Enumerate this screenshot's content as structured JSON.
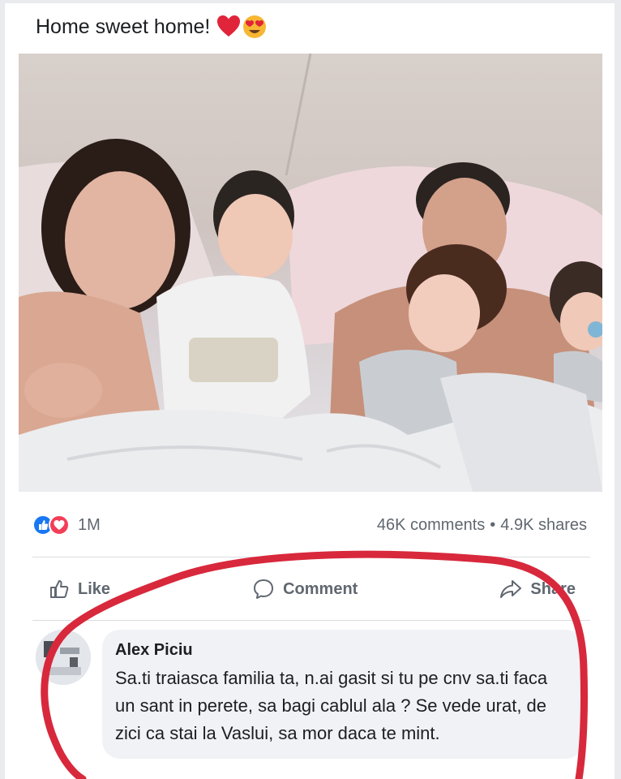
{
  "post": {
    "text": "Home sweet home!",
    "emojis": [
      "heart-emoji",
      "heart-eyes-emoji"
    ]
  },
  "stats": {
    "reactions_count": "1M",
    "comments": "46K comments",
    "separator": "•",
    "shares": "4.9K shares"
  },
  "actions": {
    "like": "Like",
    "comment": "Comment",
    "share": "Share"
  },
  "comment": {
    "author": "Alex Piciu",
    "body": "Sa.ti traiasca familia ta, n.ai gasit si tu pe cnv sa.ti faca un sant in perete, sa bagi cablul ala ? Se vede urat, de zici ca stai la Vaslui, sa mor daca te mint."
  },
  "colors": {
    "like_blue": "#1877f2",
    "love_red": "#f33e58",
    "annotation_red": "#d8283c"
  }
}
